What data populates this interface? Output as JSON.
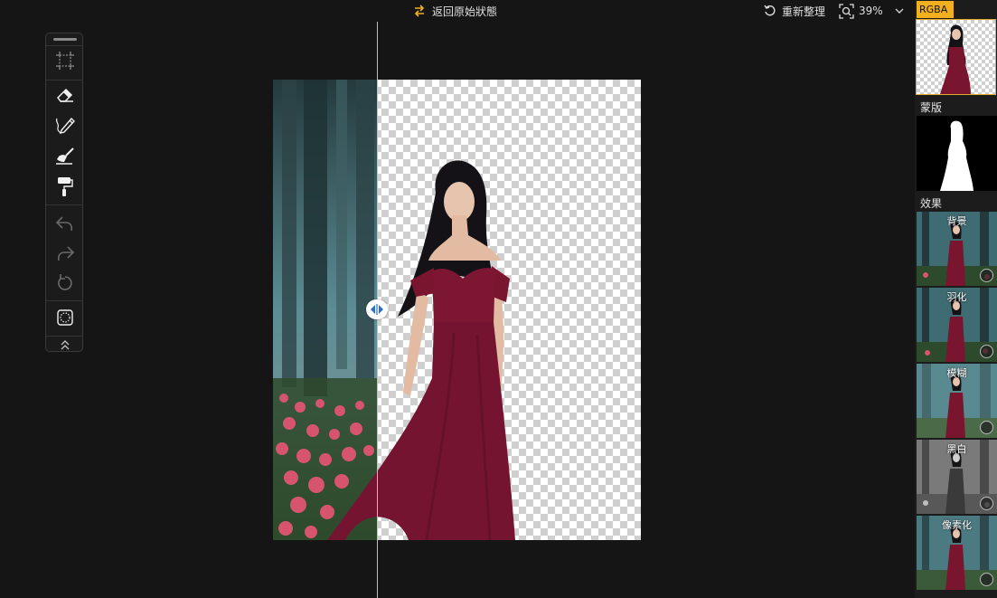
{
  "topbar": {
    "revert_label": "返回原始狀態",
    "reset_label": "重新整理",
    "zoom_value": "39%"
  },
  "toolbar": {
    "tools": [
      "transform-icon",
      "eraser-icon",
      "pencil-brush-icon",
      "restore-brush-icon",
      "paint-roller-icon",
      "undo-icon",
      "redo-icon",
      "reset-icon",
      "selection-icon",
      "collapse-icon"
    ]
  },
  "right_panel": {
    "rgba_tab": "RGBA",
    "mask_label": "蒙版",
    "effects_label": "效果",
    "effects": [
      {
        "label": "背景"
      },
      {
        "label": "羽化"
      },
      {
        "label": "模糊"
      },
      {
        "label": "黑白"
      },
      {
        "label": "像素化"
      }
    ]
  },
  "colors": {
    "accent": "#f2b01e",
    "split_line": "#f2c230",
    "dress": "#7a1530",
    "background": "#151515"
  }
}
